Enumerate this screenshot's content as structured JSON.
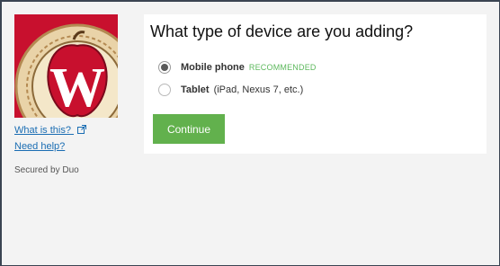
{
  "colors": {
    "accent_green": "#62b14d",
    "link_blue": "#1a6db3",
    "logo_red": "#c8102e",
    "recommended_green": "#5cb85c"
  },
  "sidebar": {
    "logo_alt": "W",
    "what_is_this": "What is this?",
    "need_help": "Need help?",
    "secured_by": "Secured by Duo"
  },
  "main": {
    "title": "What type of device are you adding?",
    "options": [
      {
        "label": "Mobile phone",
        "badge": "RECOMMENDED",
        "hint": "",
        "selected": true
      },
      {
        "label": "Tablet",
        "badge": "",
        "hint": "(iPad, Nexus 7, etc.)",
        "selected": false
      }
    ],
    "continue_label": "Continue"
  }
}
